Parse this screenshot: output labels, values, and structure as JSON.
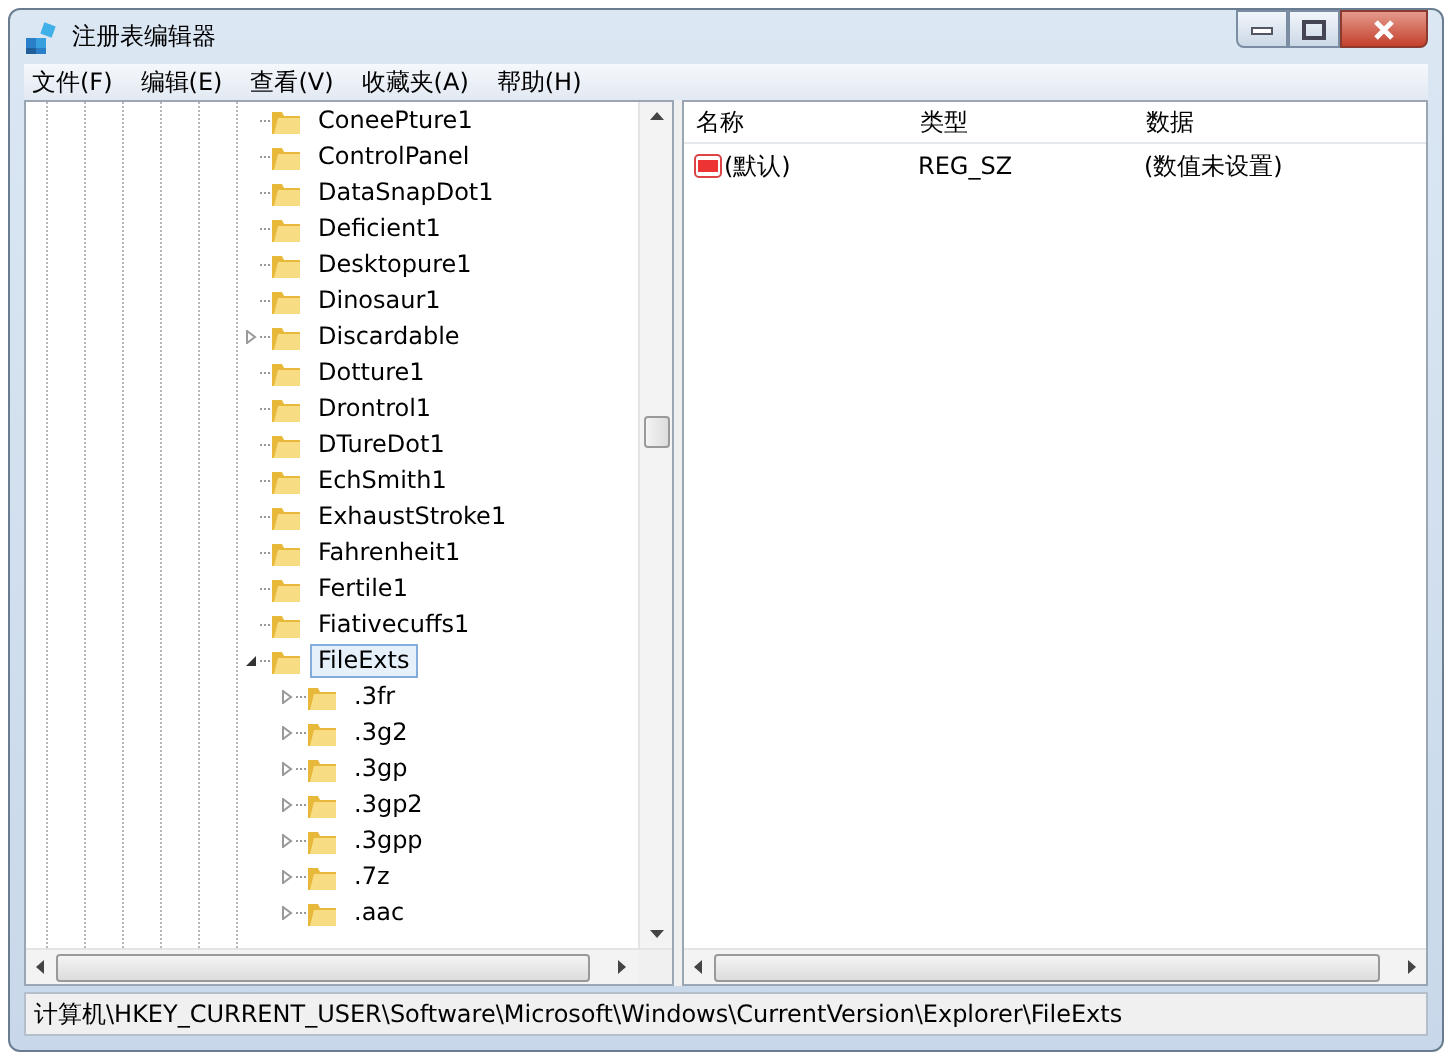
{
  "window": {
    "title": "注册表编辑器"
  },
  "menu": [
    "文件(F)",
    "编辑(E)",
    "查看(V)",
    "收藏夹(A)",
    "帮助(H)"
  ],
  "tree": [
    {
      "label": "ConeePture1",
      "kind": "leaf",
      "selected": false
    },
    {
      "label": "ControlPanel",
      "kind": "leaf",
      "selected": false
    },
    {
      "label": "DataSnapDot1",
      "kind": "leaf",
      "selected": false
    },
    {
      "label": "Deficient1",
      "kind": "leaf",
      "selected": false
    },
    {
      "label": "Desktopure1",
      "kind": "leaf",
      "selected": false
    },
    {
      "label": "Dinosaur1",
      "kind": "leaf",
      "selected": false
    },
    {
      "label": "Discardable",
      "kind": "branch",
      "expanded": false,
      "selected": false
    },
    {
      "label": "Dotture1",
      "kind": "leaf",
      "selected": false
    },
    {
      "label": "Drontrol1",
      "kind": "leaf",
      "selected": false
    },
    {
      "label": "DTureDot1",
      "kind": "leaf",
      "selected": false
    },
    {
      "label": "EchSmith1",
      "kind": "leaf",
      "selected": false
    },
    {
      "label": "ExhaustStroke1",
      "kind": "leaf",
      "selected": false
    },
    {
      "label": "Fahrenheit1",
      "kind": "leaf",
      "selected": false
    },
    {
      "label": "Fertile1",
      "kind": "leaf",
      "selected": false
    },
    {
      "label": "Fiativecuffs1",
      "kind": "leaf",
      "selected": false
    },
    {
      "label": "FileExts",
      "kind": "branch",
      "expanded": true,
      "selected": true,
      "children": [
        {
          "label": ".3fr",
          "kind": "branch",
          "expanded": false,
          "selected": false
        },
        {
          "label": ".3g2",
          "kind": "branch",
          "expanded": false,
          "selected": false
        },
        {
          "label": ".3gp",
          "kind": "branch",
          "expanded": false,
          "selected": false
        },
        {
          "label": ".3gp2",
          "kind": "branch",
          "expanded": false,
          "selected": false
        },
        {
          "label": ".3gpp",
          "kind": "branch",
          "expanded": false,
          "selected": false
        },
        {
          "label": ".7z",
          "kind": "branch",
          "expanded": false,
          "selected": false
        },
        {
          "label": ".aac",
          "kind": "branch",
          "expanded": false,
          "selected": false
        }
      ]
    }
  ],
  "values": {
    "columns": [
      "名称",
      "类型",
      "数据"
    ],
    "rows": [
      {
        "name": "(默认)",
        "type": "REG_SZ",
        "data": "(数值未设置)"
      }
    ]
  },
  "status_bar": "计算机\\HKEY_CURRENT_USER\\Software\\Microsoft\\Windows\\CurrentVersion\\Explorer\\FileExts"
}
